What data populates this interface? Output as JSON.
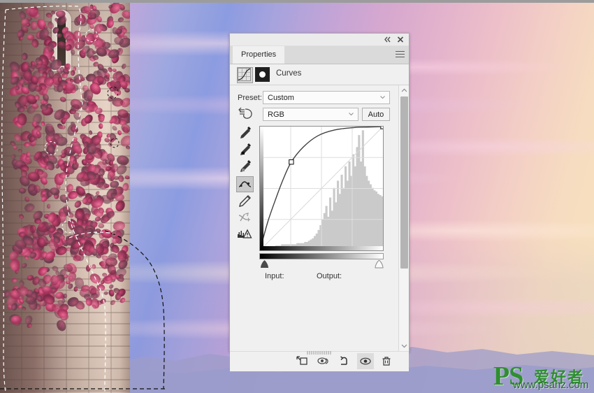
{
  "app": {
    "panel_title": "Properties",
    "adjustment_name": "Curves"
  },
  "titlebar": {
    "collapse_icon": "double-chevron-left-icon",
    "close_icon": "close-x-icon",
    "menu_icon": "hamburger-menu-icon"
  },
  "header": {
    "adjustment_icon": "curves-adjustment-icon",
    "mask_icon": "layer-mask-icon"
  },
  "controls": {
    "preset_label": "Preset:",
    "preset_value": "Custom",
    "channel_value": "RGB",
    "auto_label": "Auto",
    "curve_pencil_icon": "curves-presets-icon",
    "caret_icon": "chevron-down-icon"
  },
  "tools": [
    {
      "name": "sample-in-image-eyedropper",
      "icon": "eyedropper-icon",
      "selected": false
    },
    {
      "name": "black-point-eyedropper",
      "icon": "eyedropper-black-icon",
      "selected": false
    },
    {
      "name": "gray-point-eyedropper",
      "icon": "eyedropper-gray-icon",
      "selected": false
    },
    {
      "name": "edit-points-curve-tool",
      "icon": "curve-point-icon",
      "selected": true
    },
    {
      "name": "draw-curve-pencil-tool",
      "icon": "pencil-icon",
      "selected": false
    },
    {
      "name": "smooth-curve-tool",
      "icon": "smooth-curve-icon",
      "selected": false
    },
    {
      "name": "clipping-warning-toggle",
      "icon": "histogram-warning-icon",
      "selected": false
    }
  ],
  "graph": {
    "input_label": "Input:",
    "output_label": "Output:",
    "input_value": "",
    "output_value": "",
    "black_slider_icon": "black-point-slider-icon",
    "white_slider_icon": "white-point-slider-icon"
  },
  "chart_data": {
    "type": "line",
    "title": "Curves",
    "xlabel": "Input",
    "ylabel": "Output",
    "xlim": [
      0,
      255
    ],
    "ylim": [
      0,
      255
    ],
    "grid": true,
    "grid_divisions": 4,
    "channel": "RGB",
    "points": [
      {
        "input": 0,
        "output": 0
      },
      {
        "input": 65,
        "output": 182
      },
      {
        "input": 255,
        "output": 255
      }
    ],
    "baseline": {
      "from": [
        0,
        0
      ],
      "to": [
        255,
        255
      ]
    },
    "series": [
      {
        "name": "curve",
        "x": [
          0,
          16,
          32,
          48,
          65,
          90,
          120,
          155,
          195,
          225,
          255
        ],
        "values": [
          0,
          58,
          104,
          146,
          182,
          213,
          236,
          248,
          253,
          254,
          255
        ]
      }
    ],
    "histogram": {
      "bins": 64,
      "values": [
        2,
        2,
        2,
        2,
        3,
        3,
        3,
        3,
        4,
        4,
        4,
        5,
        5,
        5,
        5,
        5,
        5,
        5,
        5,
        6,
        6,
        6,
        6,
        7,
        7,
        8,
        9,
        10,
        12,
        14,
        17,
        21,
        26,
        31,
        37,
        28,
        44,
        33,
        52,
        40,
        58,
        47,
        63,
        52,
        70,
        58,
        74,
        62,
        80,
        70,
        86,
        96,
        74,
        100,
        70,
        62,
        58,
        55,
        52,
        50,
        49,
        47,
        46,
        45
      ],
      "peak_bin": 51,
      "peak_value": 96
    }
  },
  "scrollbar": {
    "up_icon": "chevron-up-icon",
    "down_icon": "chevron-down-icon"
  },
  "footer": [
    {
      "name": "clip-to-layer-button",
      "icon": "clip-to-layer-icon",
      "active": false
    },
    {
      "name": "toggle-previous-state-button",
      "icon": "eye-previous-state-icon",
      "active": false
    },
    {
      "name": "reset-adjustment-button",
      "icon": "reset-arrow-icon",
      "active": false
    },
    {
      "name": "toggle-layer-visibility-button",
      "icon": "eye-icon",
      "active": true
    },
    {
      "name": "delete-adjustment-button",
      "icon": "trash-icon",
      "active": false
    }
  ],
  "watermark": {
    "logo": "PS",
    "chinese": "爱好者",
    "url": "www.psahz.com",
    "color": "#2f8f2f"
  },
  "theme": {
    "panel_bg": "#f0f0f0",
    "panel_border": "#a9a9a9",
    "tab_inactive_bg": "#dadada",
    "selected_tool_bg": "#c9c9c9",
    "graph_bg": "#ffffff",
    "histogram_fill": "#c8c8c8",
    "curve_stroke": "#404040"
  },
  "image": {
    "subject": "brick-tower-with-pink-ivy",
    "background": "sunset-sky-with-mountains",
    "selection": "marching-ants-selection-path"
  }
}
